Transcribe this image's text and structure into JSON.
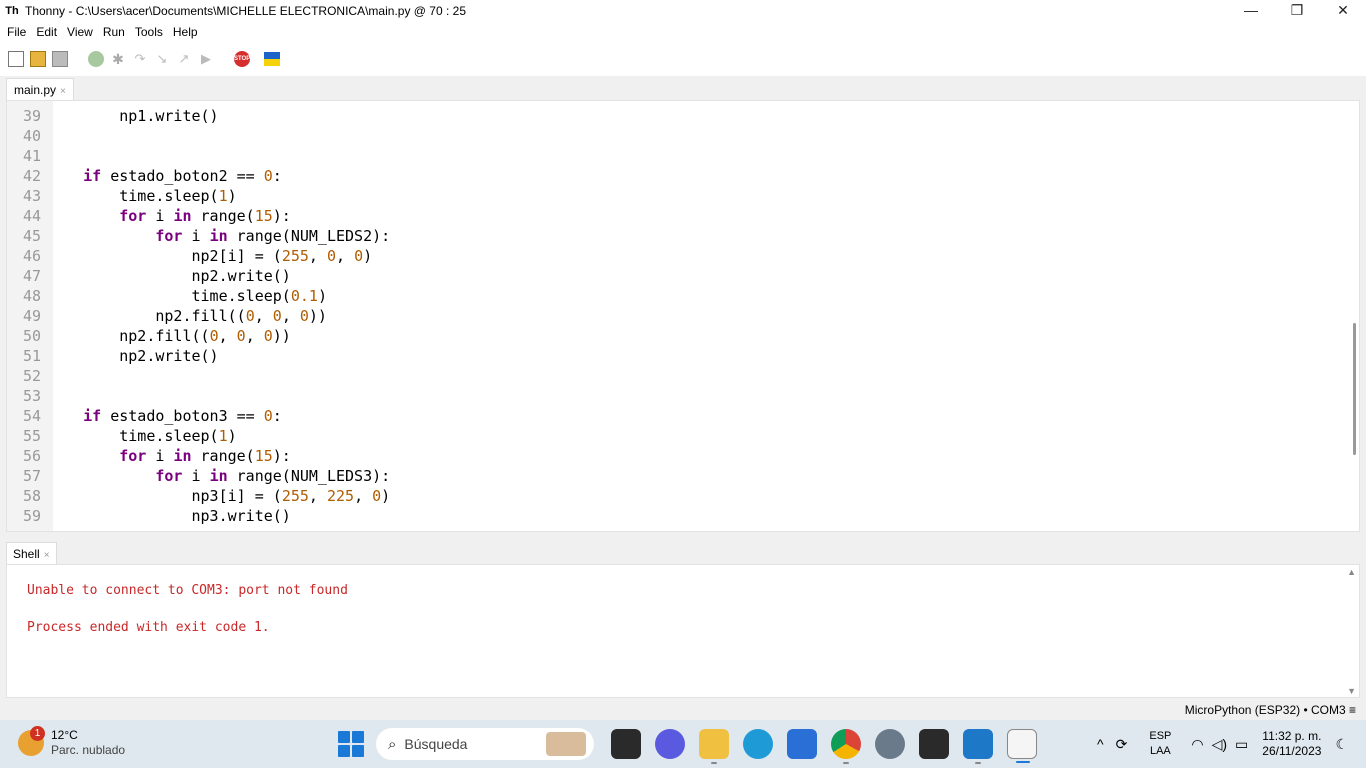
{
  "window": {
    "app_icon": "Th",
    "title": "Thonny  -  C:\\Users\\acer\\Documents\\MICHELLE ELECTRONICA\\main.py  @  70 : 25",
    "controls": [
      "—",
      "❐",
      "✕"
    ]
  },
  "menu": [
    "File",
    "Edit",
    "View",
    "Run",
    "Tools",
    "Help"
  ],
  "toolbar": {
    "icons": [
      "new-file-icon",
      "open-file-icon",
      "save-file-icon",
      "run-icon",
      "debug-icon",
      "step-over-icon",
      "step-into-icon",
      "step-out-icon",
      "resume-icon",
      "stop-icon",
      "ukraine-flag-icon"
    ],
    "stop_label": "STOP"
  },
  "editor": {
    "tab_label": "main.py",
    "tab_close": "×",
    "lines": [
      {
        "n": "39",
        "code": "        np1.write()"
      },
      {
        "n": "40",
        "code": ""
      },
      {
        "n": "41",
        "code": ""
      },
      {
        "n": "42",
        "code": "    if estado_boton2 == 0:"
      },
      {
        "n": "43",
        "code": "        time.sleep(1)"
      },
      {
        "n": "44",
        "code": "        for i in range(15):"
      },
      {
        "n": "45",
        "code": "            for i in range(NUM_LEDS2):"
      },
      {
        "n": "46",
        "code": "                np2[i] = (255, 0, 0)"
      },
      {
        "n": "47",
        "code": "                np2.write()"
      },
      {
        "n": "48",
        "code": "                time.sleep(0.1)"
      },
      {
        "n": "49",
        "code": "            np2.fill((0, 0, 0))"
      },
      {
        "n": "50",
        "code": "        np2.fill((0, 0, 0))"
      },
      {
        "n": "51",
        "code": "        np2.write()"
      },
      {
        "n": "52",
        "code": ""
      },
      {
        "n": "53",
        "code": ""
      },
      {
        "n": "54",
        "code": "    if estado_boton3 == 0:"
      },
      {
        "n": "55",
        "code": "        time.sleep(1)"
      },
      {
        "n": "56",
        "code": "        for i in range(15):"
      },
      {
        "n": "57",
        "code": "            for i in range(NUM_LEDS3):"
      },
      {
        "n": "58",
        "code": "                np3[i] = (255, 225, 0)"
      },
      {
        "n": "59",
        "code": "                np3.write()"
      }
    ]
  },
  "shell": {
    "tab_label": "Shell",
    "tab_close": "×",
    "lines": [
      "Unable to connect to COM3: port not found",
      "Process ended with exit code 1."
    ]
  },
  "status": {
    "backend": "MicroPython (ESP32)  •  COM3  ≡"
  },
  "taskbar": {
    "weather_temp": "12°C",
    "weather_desc": "Parc. nublado",
    "weather_badge": "1",
    "search_placeholder": "Búsqueda",
    "apps": [
      "task-view-icon",
      "chat-icon",
      "file-explorer-icon",
      "edge-icon",
      "store-icon",
      "chrome-icon",
      "settings-icon",
      "terminal-icon",
      "vscode-icon",
      "thonny-icon"
    ],
    "lang_top": "ESP",
    "lang_bottom": "LAA",
    "time": "11:32 p. m.",
    "date": "26/11/2023"
  }
}
